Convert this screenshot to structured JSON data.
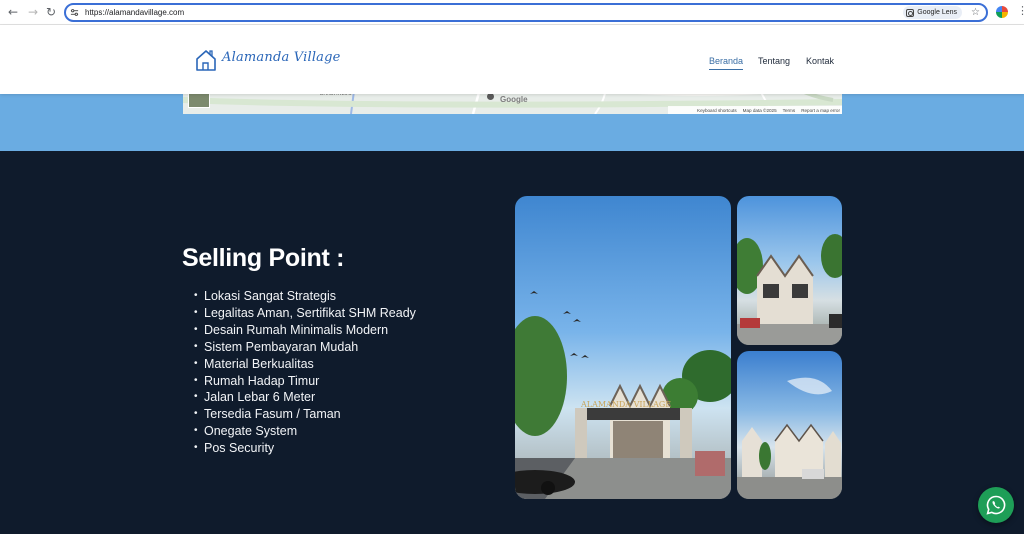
{
  "browser": {
    "url": "https://alamandavillage.com",
    "lens_label": "Google Lens"
  },
  "site": {
    "logo_text": "Alamanda Village",
    "nav": [
      {
        "label": "Beranda",
        "active": true
      },
      {
        "label": "Tentang",
        "active": false
      },
      {
        "label": "Kontak",
        "active": false
      }
    ]
  },
  "map": {
    "google_label": "Google",
    "road_label": "BANJAREJO",
    "footer": [
      "Keyboard shortcuts",
      "Map data ©2025",
      "Terms",
      "Report a map error"
    ]
  },
  "selling": {
    "title": "Selling Point :",
    "items": [
      "Lokasi Sangat Strategis",
      "Legalitas Aman, Sertifikat SHM Ready",
      "Desain Rumah Minimalis Modern",
      "Sistem Pembayaran Mudah",
      "Material Berkualitas",
      "Rumah Hadap Timur",
      "Jalan Lebar 6 Meter",
      "Tersedia Fasum / Taman",
      "Onegate System",
      "Pos Security"
    ]
  },
  "photos": {
    "gate_sign": "ALAMANDA VILLAGE"
  },
  "colors": {
    "accent": "#3a6ea5",
    "band": "#6aace2",
    "dark_bg": "#0f1b2c",
    "whatsapp": "#1e9e57"
  },
  "icons": {
    "back": "arrow-left-icon",
    "forward": "arrow-right-icon",
    "reload": "reload-icon",
    "bookmark": "star-icon",
    "whatsapp": "whatsapp-icon"
  }
}
